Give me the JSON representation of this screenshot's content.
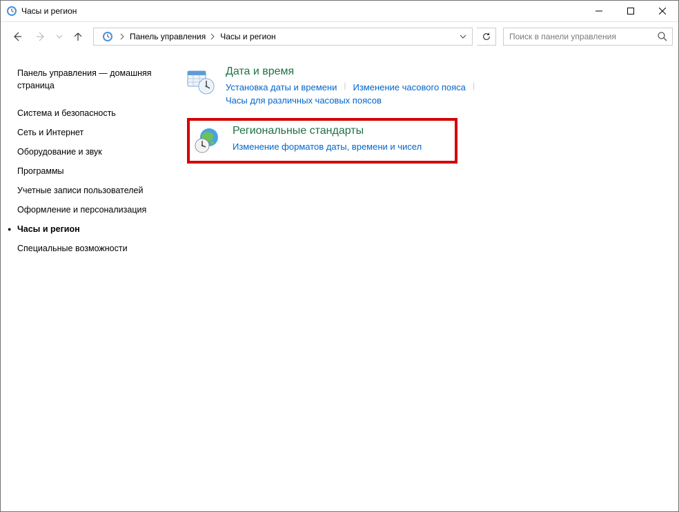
{
  "window": {
    "title": "Часы и регион"
  },
  "breadcrumbs": {
    "root": "Панель управления",
    "current": "Часы и регион"
  },
  "search": {
    "placeholder": "Поиск в панели управления"
  },
  "sidebar": {
    "items": [
      {
        "label": "Панель управления — домашняя страница",
        "active": false
      },
      {
        "label": "Система и безопасность",
        "active": false
      },
      {
        "label": "Сеть и Интернет",
        "active": false
      },
      {
        "label": "Оборудование и звук",
        "active": false
      },
      {
        "label": "Программы",
        "active": false
      },
      {
        "label": "Учетные записи пользователей",
        "active": false
      },
      {
        "label": "Оформление и персонализация",
        "active": false
      },
      {
        "label": "Часы и регион",
        "active": true
      },
      {
        "label": "Специальные возможности",
        "active": false
      }
    ]
  },
  "main": {
    "datetime": {
      "title": "Дата и время",
      "links": [
        "Установка даты и времени",
        "Изменение часового пояса",
        "Часы для различных часовых поясов"
      ]
    },
    "region": {
      "title": "Региональные стандарты",
      "link": "Изменение форматов даты, времени и чисел"
    }
  }
}
